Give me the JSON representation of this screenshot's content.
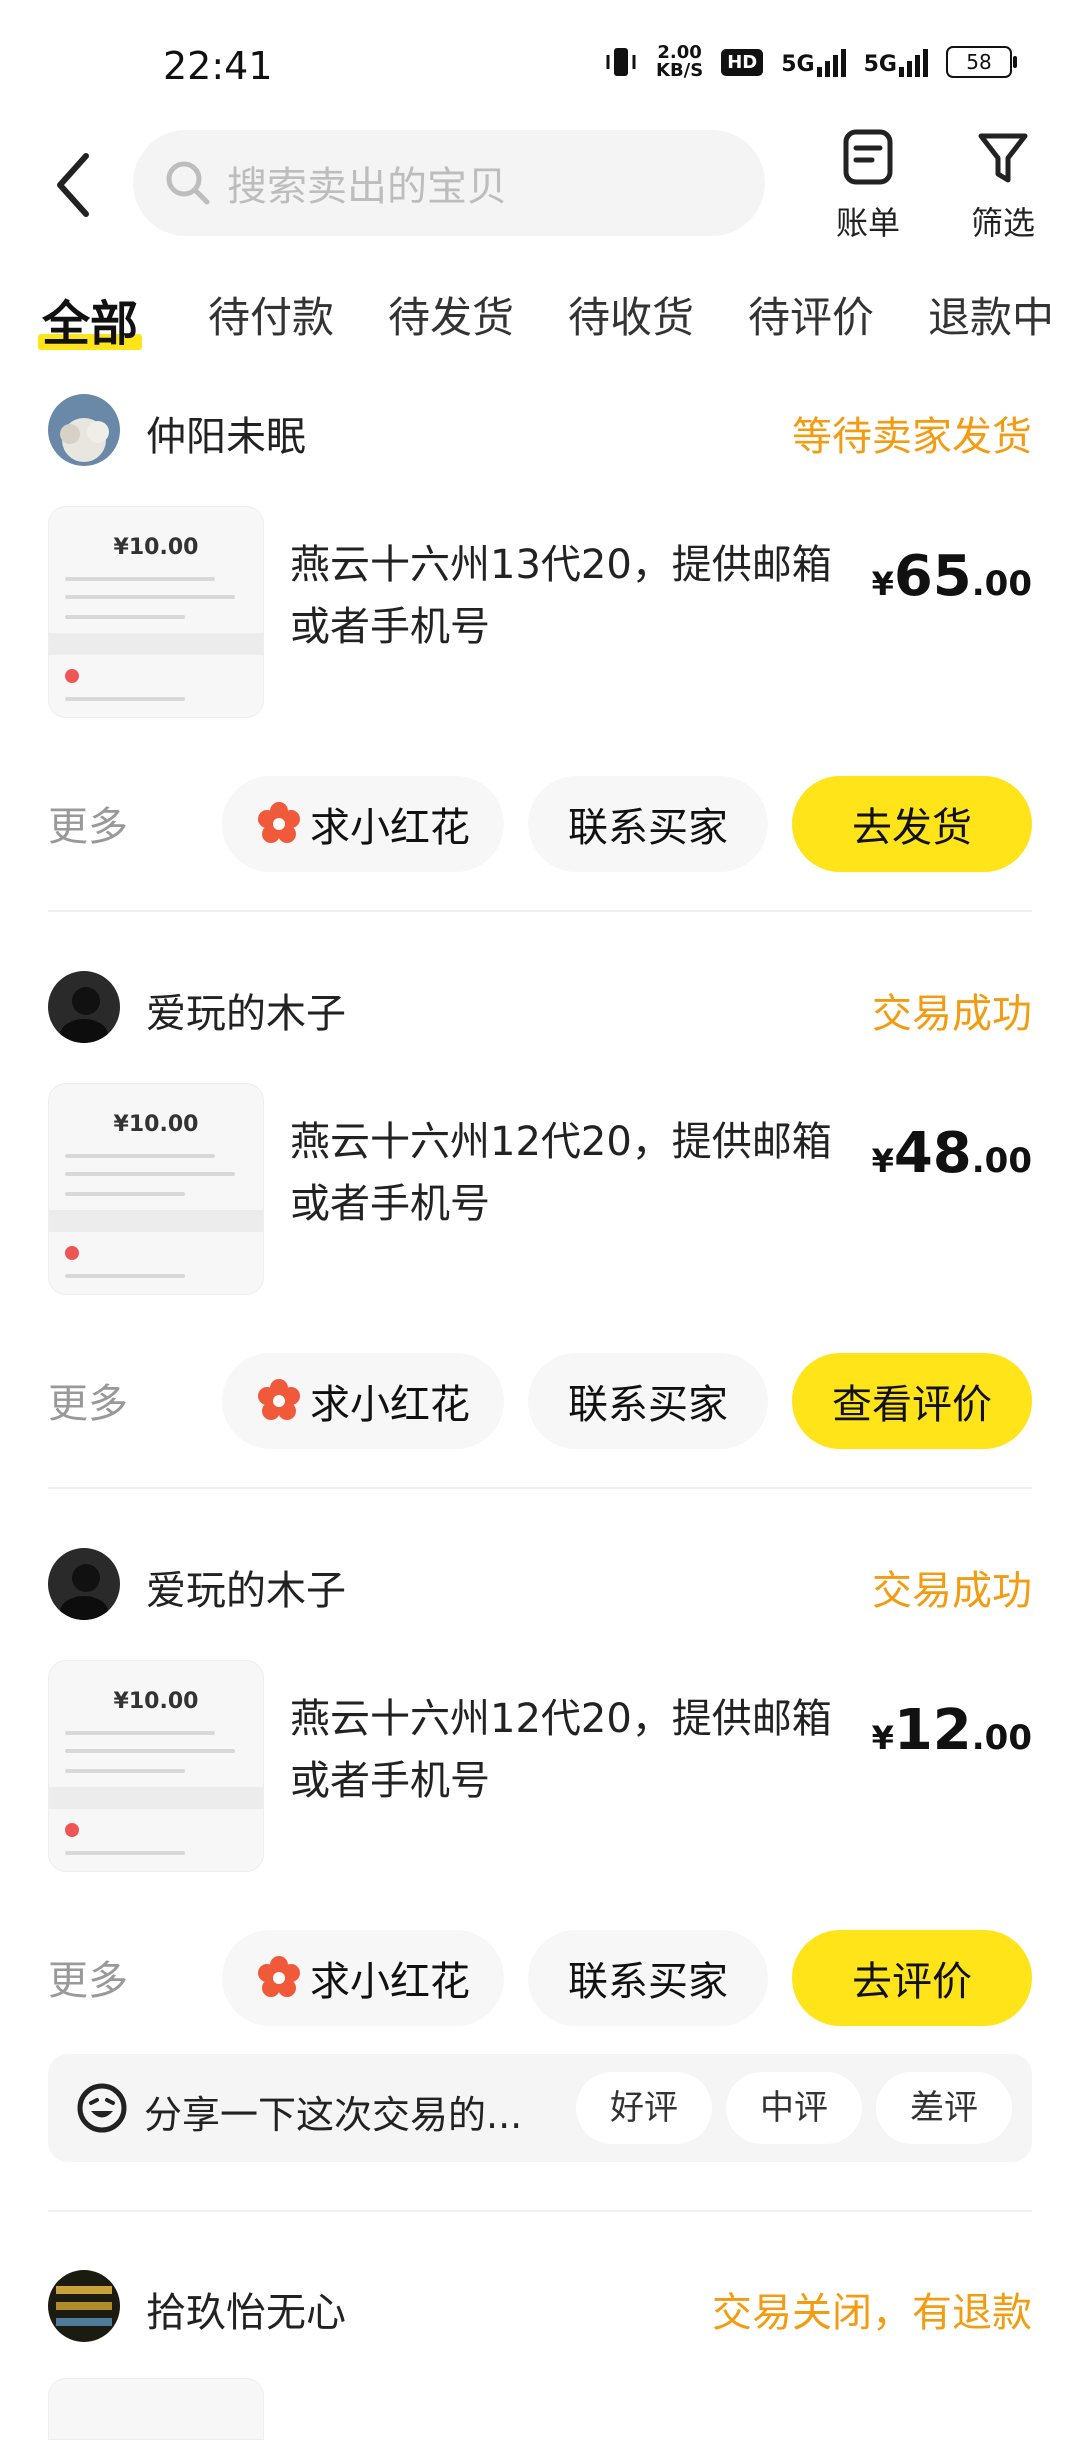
{
  "status_bar": {
    "time": "22:41",
    "net_speed_top": "2.00",
    "net_speed_bottom": "KB/S",
    "hd": "HD",
    "sig1": "5G",
    "sig2": "5G",
    "battery": "58"
  },
  "header": {
    "search_placeholder": "搜索卖出的宝贝",
    "bill_label": "账单",
    "filter_label": "筛选"
  },
  "tabs": [
    "全部",
    "待付款",
    "待发货",
    "待收货",
    "待评价",
    "退款中"
  ],
  "orders": [
    {
      "seller": "仲阳未眠",
      "status": "等待卖家发货",
      "title": "燕云十六州13代20，提供邮箱或者手机号",
      "price_yen": "¥",
      "price_int": "65",
      "price_dec": ".00",
      "thumb_price": "¥10.00",
      "more": "更多",
      "btn1": "求小红花",
      "btn2": "联系买家",
      "btn3": "去发货"
    },
    {
      "seller": "爱玩的木子",
      "status": "交易成功",
      "title": "燕云十六州12代20，提供邮箱或者手机号",
      "price_yen": "¥",
      "price_int": "48",
      "price_dec": ".00",
      "thumb_price": "¥10.00",
      "more": "更多",
      "btn1": "求小红花",
      "btn2": "联系买家",
      "btn3": "查看评价"
    },
    {
      "seller": "爱玩的木子",
      "status": "交易成功",
      "title": "燕云十六州12代20，提供邮箱或者手机号",
      "price_yen": "¥",
      "price_int": "12",
      "price_dec": ".00",
      "thumb_price": "¥10.00",
      "more": "更多",
      "btn1": "求小红花",
      "btn2": "联系买家",
      "btn3": "去评价"
    },
    {
      "seller": "拾玖怡无心",
      "status": "交易关闭，有退款"
    }
  ],
  "share": {
    "text": "分享一下这次交易的...",
    "good": "好评",
    "mid": "中评",
    "bad": "差评"
  },
  "colors": {
    "accent": "#ffe41a",
    "status": "#f39c12"
  }
}
